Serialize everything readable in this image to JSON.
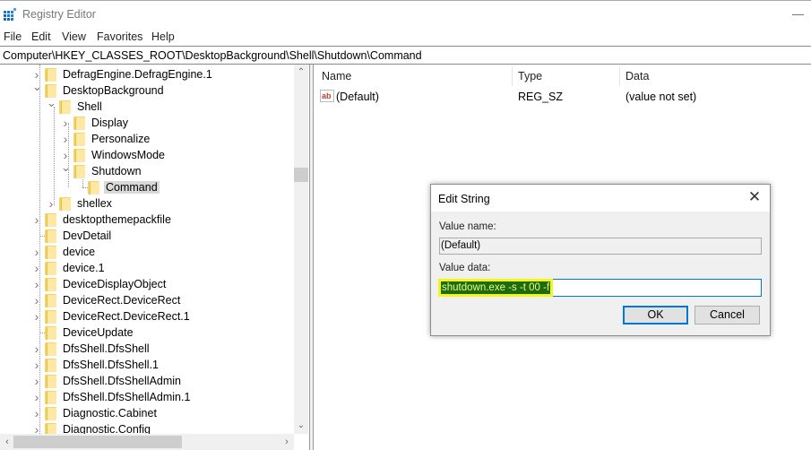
{
  "window": {
    "title": "Registry Editor",
    "icon": "registry-icon"
  },
  "menu": [
    "File",
    "Edit",
    "View",
    "Favorites",
    "Help"
  ],
  "address": "Computer\\HKEY_CLASSES_ROOT\\DesktopBackground\\Shell\\Shutdown\\Command",
  "tree": [
    {
      "label": "DefragEngine.DefragEngine.1",
      "level": 0,
      "expander": "collapsed"
    },
    {
      "label": "DesktopBackground",
      "level": 0,
      "expander": "expanded"
    },
    {
      "label": "Shell",
      "level": 1,
      "expander": "expanded"
    },
    {
      "label": "Display",
      "level": 2,
      "expander": "collapsed"
    },
    {
      "label": "Personalize",
      "level": 2,
      "expander": "collapsed"
    },
    {
      "label": "WindowsMode",
      "level": 2,
      "expander": "collapsed"
    },
    {
      "label": "Shutdown",
      "level": 2,
      "expander": "expanded"
    },
    {
      "label": "Command",
      "level": 3,
      "expander": "none",
      "selected": true
    },
    {
      "label": "shellex",
      "level": 1,
      "expander": "collapsed"
    },
    {
      "label": "desktopthemepackfile",
      "level": 0,
      "expander": "collapsed"
    },
    {
      "label": "DevDetail",
      "level": 0,
      "expander": "none"
    },
    {
      "label": "device",
      "level": 0,
      "expander": "collapsed"
    },
    {
      "label": "device.1",
      "level": 0,
      "expander": "collapsed"
    },
    {
      "label": "DeviceDisplayObject",
      "level": 0,
      "expander": "collapsed"
    },
    {
      "label": "DeviceRect.DeviceRect",
      "level": 0,
      "expander": "collapsed"
    },
    {
      "label": "DeviceRect.DeviceRect.1",
      "level": 0,
      "expander": "collapsed"
    },
    {
      "label": "DeviceUpdate",
      "level": 0,
      "expander": "none"
    },
    {
      "label": "DfsShell.DfsShell",
      "level": 0,
      "expander": "collapsed"
    },
    {
      "label": "DfsShell.DfsShell.1",
      "level": 0,
      "expander": "collapsed"
    },
    {
      "label": "DfsShell.DfsShellAdmin",
      "level": 0,
      "expander": "collapsed"
    },
    {
      "label": "DfsShell.DfsShellAdmin.1",
      "level": 0,
      "expander": "collapsed"
    },
    {
      "label": "Diagnostic.Cabinet",
      "level": 0,
      "expander": "collapsed"
    },
    {
      "label": "Diagnostic.Config",
      "level": 0,
      "expander": "collapsed"
    }
  ],
  "list": {
    "columns": [
      "Name",
      "Type",
      "Data"
    ],
    "rows": [
      {
        "name": "(Default)",
        "type": "REG_SZ",
        "data": "(value not set)",
        "icon": "string-value-icon"
      }
    ]
  },
  "dialog": {
    "title": "Edit String",
    "value_name_label": "Value name:",
    "value_name": "(Default)",
    "value_data_label": "Value data:",
    "value_data": "shutdown.exe -s -t 00 -f",
    "ok_label": "OK",
    "cancel_label": "Cancel"
  }
}
